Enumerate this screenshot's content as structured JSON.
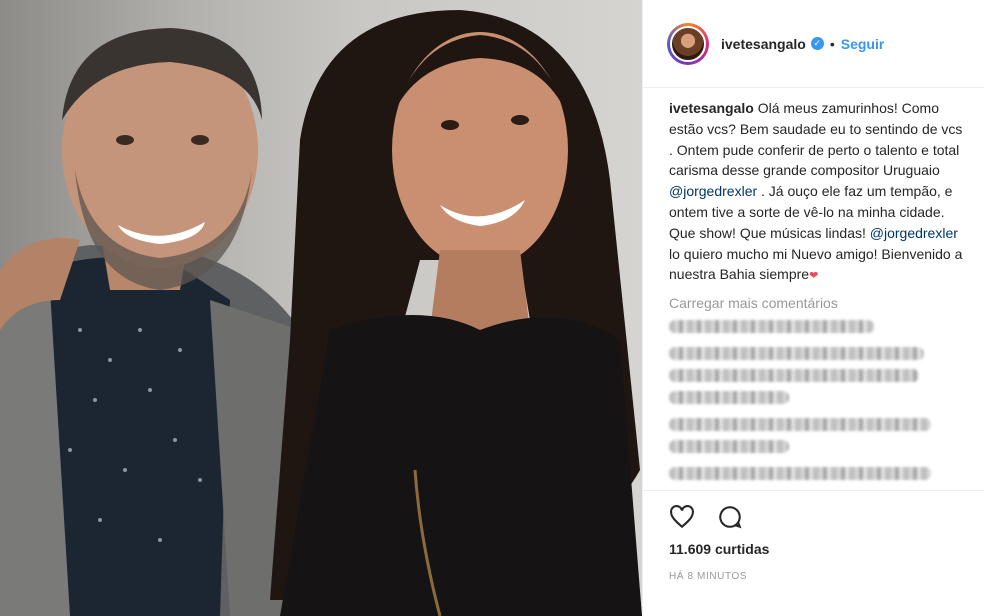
{
  "header": {
    "username": "ivetesangalo",
    "separator": "•",
    "follow_label": "Seguir"
  },
  "caption": {
    "username": "ivetesangalo",
    "text_1": " Olá meus zamurinhos! Como estão vcs? Bem saudade eu to sentindo de vcs . Ontem pude conferir de perto o talento e total carisma desse grande compositor Uruguaio ",
    "mention_1": "@jorgedrexler",
    "text_2": " . Já ouço ele faz um tempão, e ontem tive a sorte de vê-lo na minha cidade. Que show! Que músicas lindas! ",
    "mention_2": "@jorgedrexler",
    "text_3": " lo quiero mucho mi Nuevo amigo! Bienvenido a nuestra Bahia siempre",
    "emoji": "❤"
  },
  "comments": {
    "load_more_label": "Carregar mais comentários"
  },
  "actions": {
    "like_icon": "heart-outline-icon",
    "comment_icon": "comment-bubble-icon"
  },
  "stats": {
    "likes": "11.609 curtidas",
    "time": "HÁ 8 MINUTOS"
  },
  "colors": {
    "link": "#003569",
    "follow": "#3897f0",
    "muted": "#999999"
  }
}
